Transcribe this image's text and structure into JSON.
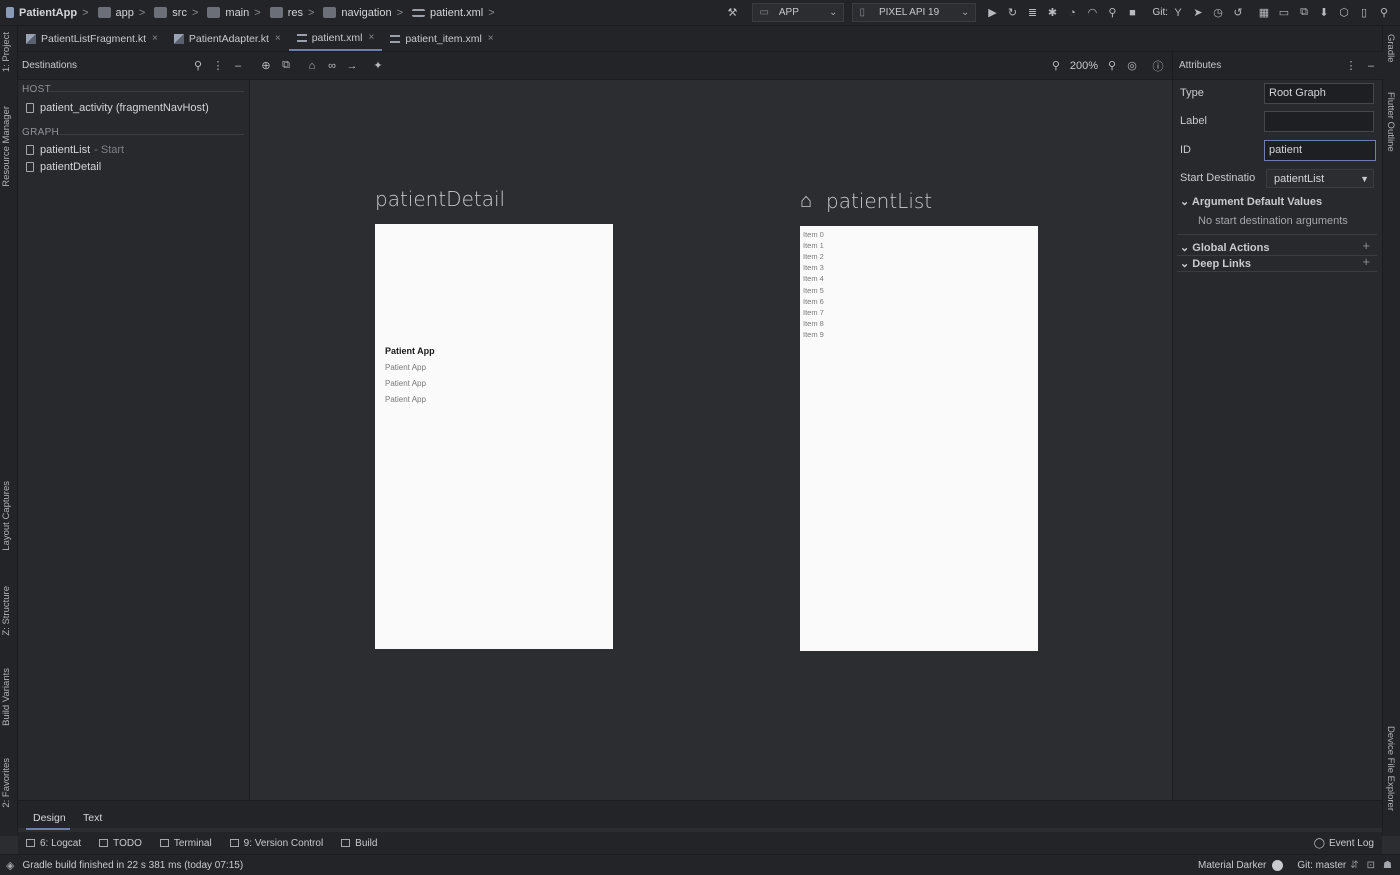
{
  "navbar": {
    "breadcrumbs": [
      "PatientApp",
      "app",
      "src",
      "main",
      "res",
      "navigation",
      "patient.xml"
    ],
    "run_config": "APP",
    "device": "PIXEL API 19",
    "git_label": "Git:"
  },
  "tabs": [
    {
      "label": "PatientListFragment.kt",
      "type": "kt"
    },
    {
      "label": "PatientAdapter.kt",
      "type": "kt"
    },
    {
      "label": "patient.xml",
      "type": "xml",
      "active": true
    },
    {
      "label": "patient_item.xml",
      "type": "xml"
    }
  ],
  "left_strip": [
    "1: Project",
    "Resource Manager",
    "Layout Captures",
    "Z: Structure",
    "Build Variants",
    "2: Favorites"
  ],
  "right_strip": [
    "Gradle",
    "Flutter Outline",
    "Device File Explorer"
  ],
  "destinations": {
    "title": "Destinations",
    "host_header": "HOST",
    "host_item": "patient_activity (fragmentNavHost)",
    "graph_header": "GRAPH",
    "graph_items": [
      {
        "label": "patientList",
        "suffix": "- Start"
      },
      {
        "label": "patientDetail",
        "suffix": ""
      }
    ]
  },
  "canvas": {
    "zoom": "200%",
    "patient_detail": {
      "title": "patientDetail",
      "bold_text": "Patient App",
      "sub_texts": [
        "Patient App",
        "Patient App",
        "Patient App"
      ]
    },
    "patient_list": {
      "title": "patientList",
      "items": [
        "Item 0",
        "Item 1",
        "Item 2",
        "Item 3",
        "Item 4",
        "Item 5",
        "Item 6",
        "Item 7",
        "Item 8",
        "Item 9"
      ]
    }
  },
  "attributes": {
    "title": "Attributes",
    "type_label": "Type",
    "type_value": "Root Graph",
    "label_label": "Label",
    "label_value": "",
    "id_label": "ID",
    "id_value": "patient",
    "start_label": "Start Destinatio",
    "start_value": "patientList",
    "arg_header": "Argument Default Values",
    "arg_empty": "No start destination arguments",
    "global_actions": "Global Actions",
    "deep_links": "Deep Links"
  },
  "bottom": {
    "design_tab": "Design",
    "text_tab": "Text",
    "tool_windows": [
      "6: Logcat",
      "TODO",
      "Terminal",
      "9: Version Control",
      "Build"
    ],
    "event_log": "Event Log",
    "status_message": "Gradle build finished in 22 s 381 ms (today 07:15)",
    "theme": "Material Darker",
    "git_branch": "Git: master"
  },
  "colors": {
    "bg": "#2b2d30",
    "panel": "#27292c",
    "accent": "#6c7fae",
    "frame": "#fafafa"
  }
}
